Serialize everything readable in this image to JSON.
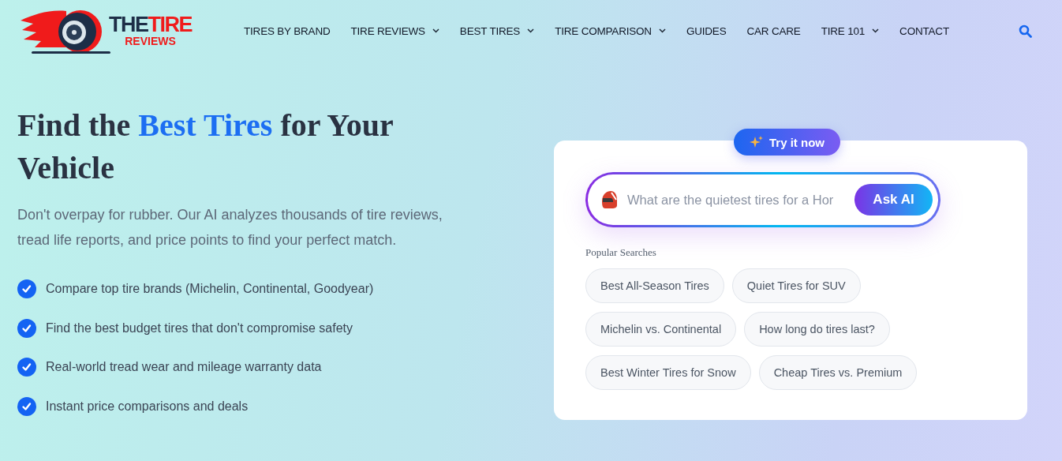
{
  "logo": {
    "dark": "THE",
    "red": "TIRE",
    "sub": "REVIEWS"
  },
  "nav": [
    {
      "label": "TIRES BY BRAND",
      "has_menu": false
    },
    {
      "label": "TIRE REVIEWS",
      "has_menu": true
    },
    {
      "label": "BEST TIRES",
      "has_menu": true
    },
    {
      "label": "TIRE COMPARISON",
      "has_menu": true
    },
    {
      "label": "GUIDES",
      "has_menu": false
    },
    {
      "label": "CAR CARE",
      "has_menu": false
    },
    {
      "label": "TIRE 101",
      "has_menu": true
    },
    {
      "label": "CONTACT",
      "has_menu": false
    }
  ],
  "headline": {
    "before": "Find the",
    "highlight": "Best Tires",
    "after": "for Your Vehicle"
  },
  "intro": "Don't overpay for rubber. Our AI analyzes thousands of tire reviews, tread life reports, and price points to find your perfect match.",
  "features": [
    "Compare top tire brands (Michelin, Continental, Goodyear)",
    "Find the best budget tires that don't compromise safety",
    "Real-world tread wear and mileage warranty data",
    "Instant price comparisons and deals"
  ],
  "ai_card": {
    "badge": "Try it now",
    "placeholder": "What are the quietest tires for a Hor",
    "button": "Ask AI",
    "popular_title": "Popular Searches",
    "chips": [
      "Best All-Season Tires",
      "Quiet Tires for SUV",
      "Michelin vs. Continental",
      "How long do tires last?",
      "Best Winter Tires for Snow",
      "Cheap Tires vs. Premium"
    ]
  }
}
